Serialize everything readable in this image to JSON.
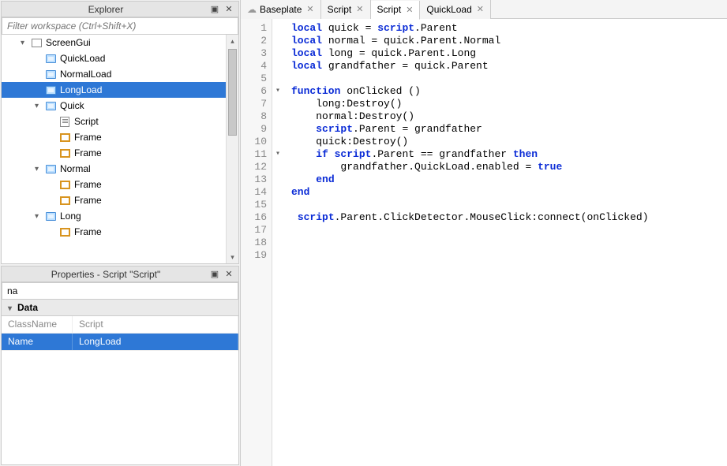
{
  "explorer": {
    "title": "Explorer",
    "filter_placeholder": "Filter workspace (Ctrl+Shift+X)",
    "items": [
      {
        "indent": 1,
        "caret": "▾",
        "icon": "gui",
        "label": "ScreenGui"
      },
      {
        "indent": 2,
        "caret": "",
        "icon": "txt",
        "label": "QuickLoad"
      },
      {
        "indent": 2,
        "caret": "",
        "icon": "txt",
        "label": "NormalLoad"
      },
      {
        "indent": 2,
        "caret": "",
        "icon": "txt",
        "label": "LongLoad",
        "selected": true
      },
      {
        "indent": 2,
        "caret": "▾",
        "icon": "txt",
        "label": "Quick"
      },
      {
        "indent": 3,
        "caret": "",
        "icon": "script",
        "label": "Script"
      },
      {
        "indent": 3,
        "caret": "",
        "icon": "frame",
        "label": "Frame"
      },
      {
        "indent": 3,
        "caret": "",
        "icon": "frame",
        "label": "Frame"
      },
      {
        "indent": 2,
        "caret": "▾",
        "icon": "txt",
        "label": "Normal"
      },
      {
        "indent": 3,
        "caret": "",
        "icon": "frame",
        "label": "Frame"
      },
      {
        "indent": 3,
        "caret": "",
        "icon": "frame",
        "label": "Frame"
      },
      {
        "indent": 2,
        "caret": "▾",
        "icon": "txt",
        "label": "Long"
      },
      {
        "indent": 3,
        "caret": "",
        "icon": "frame",
        "label": "Frame"
      }
    ]
  },
  "properties": {
    "title": "Properties - Script \"Script\"",
    "filter_value": "na",
    "section": "Data",
    "rows": [
      {
        "name": "ClassName",
        "value": "Script",
        "hdr": true
      },
      {
        "name": "Name",
        "value": "LongLoad",
        "sel": true
      }
    ]
  },
  "tabs": [
    {
      "label": "Baseplate",
      "cloud": true
    },
    {
      "label": "Script"
    },
    {
      "label": "Script",
      "active": true
    },
    {
      "label": "QuickLoad"
    }
  ],
  "code": {
    "lines": [
      [
        {
          "t": "local ",
          "c": "kw"
        },
        {
          "t": "quick = "
        },
        {
          "t": "script",
          "c": "kw"
        },
        {
          "t": ".Parent"
        }
      ],
      [
        {
          "t": "local ",
          "c": "kw"
        },
        {
          "t": "normal = quick.Parent.Normal"
        }
      ],
      [
        {
          "t": "local ",
          "c": "kw"
        },
        {
          "t": "long = quick.Parent.Long"
        }
      ],
      [
        {
          "t": "local ",
          "c": "kw"
        },
        {
          "t": "grandfather = quick.Parent"
        }
      ],
      [],
      [
        {
          "t": "function ",
          "c": "kw"
        },
        {
          "t": "onClicked ()"
        }
      ],
      [
        {
          "t": "    long:Destroy()"
        }
      ],
      [
        {
          "t": "    normal:Destroy()"
        }
      ],
      [
        {
          "t": "    "
        },
        {
          "t": "script",
          "c": "kw"
        },
        {
          "t": ".Parent = grandfather"
        }
      ],
      [
        {
          "t": "    quick:Destroy()"
        }
      ],
      [
        {
          "t": "    "
        },
        {
          "t": "if ",
          "c": "kw"
        },
        {
          "t": "script",
          "c": "kw"
        },
        {
          "t": ".Parent == grandfather "
        },
        {
          "t": "then",
          "c": "kw"
        }
      ],
      [
        {
          "t": "        grandfather.QuickLoad.enabled = "
        },
        {
          "t": "true",
          "c": "bool"
        }
      ],
      [
        {
          "t": "    "
        },
        {
          "t": "end",
          "c": "kw"
        }
      ],
      [
        {
          "t": "end",
          "c": "kw"
        }
      ],
      [],
      [
        {
          "t": " "
        },
        {
          "t": "script",
          "c": "kw"
        },
        {
          "t": ".Parent.ClickDetector.MouseClick:connect(onClicked)"
        }
      ],
      [],
      [],
      []
    ],
    "folds": {
      "6": "▾",
      "11": "▾"
    }
  }
}
